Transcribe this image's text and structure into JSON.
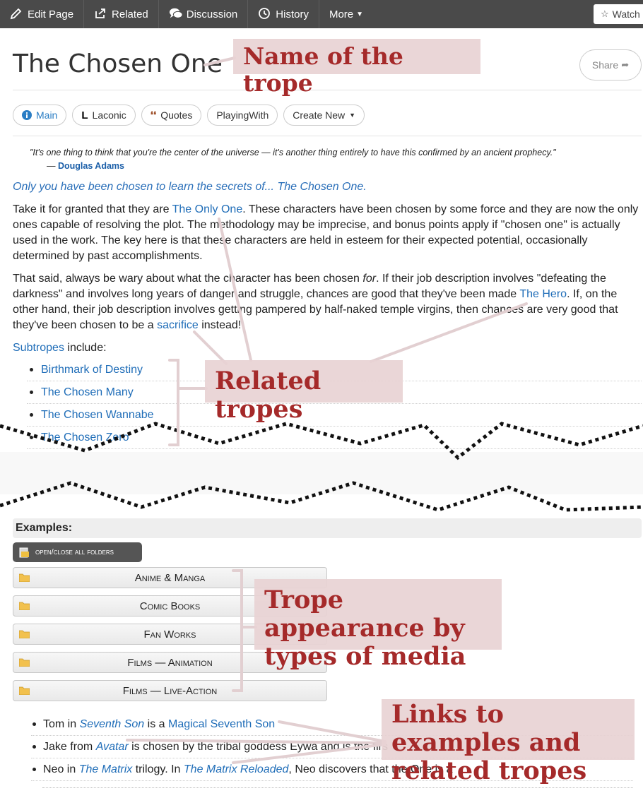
{
  "toolbar": {
    "edit_page": "Edit Page",
    "related": "Related",
    "discussion": "Discussion",
    "history": "History",
    "more": "More",
    "watch": "Watch"
  },
  "header": {
    "title": "The Chosen One",
    "share": "Share"
  },
  "tabs": {
    "main": "Main",
    "laconic": "Laconic",
    "quotes": "Quotes",
    "playingwith": "PlayingWith",
    "create_new": "Create New"
  },
  "quote": {
    "text": "\"It's one thing to think that you're the center of the universe — it's another thing entirely to have this confirmed by an ancient prophecy.\"",
    "dash": "— ",
    "author": "Douglas Adams"
  },
  "intro": "Only you have been chosen to learn the secrets of... The Chosen One.",
  "para1": {
    "a": "Take it for granted that they are ",
    "link": "The Only One",
    "b": ". These characters have been chosen by some force and they are now the only ones capable of resolving the plot. The methodology may be imprecise, and bonus points apply if \"chosen one\" is actually used in the work. The key here is that these characters are held in esteem for their expected potential, occasionally determined by past accomplishments."
  },
  "para2": {
    "a": "That said, always be wary about what the character has been chosen ",
    "em": "for",
    "b": ". If their job description involves \"defeating the darkness\" and involves long years of danger and struggle, chances are good that they've been made ",
    "link1": "The Hero",
    "c": ". If, on the other hand, their job description involves getting pampered by half-naked temple virgins, then chances are very good that they've been chosen to be a ",
    "link2": "sacrifice",
    "d": " instead!"
  },
  "subtropes": {
    "link": "Subtropes",
    "rest": " include:",
    "items": [
      "Birthmark of Destiny",
      "The Chosen Many",
      "The Chosen Wannabe",
      "The Chosen Zero"
    ]
  },
  "examples": {
    "header": "Examples:",
    "open_close": "open/close all folders",
    "folders": [
      "Anime & Manga",
      "Comic Books",
      "Fan Works",
      "Films — Animation",
      "Films — Live-Action"
    ],
    "items": [
      {
        "a": "Tom in ",
        "work": "Seventh Son",
        "b": " is a ",
        "link": "Magical Seventh Son",
        "c": ""
      },
      {
        "a": "Jake from ",
        "work": "Avatar",
        "b": " is chosen by the tribal goddess Eywa and is the firs",
        "link": "",
        "c": ""
      },
      {
        "a": "Neo in ",
        "work": "The Matrix",
        "b": " trilogy. In ",
        "link": "The Matrix Reloaded",
        "c": ", Neo discovers that the One is a "
      }
    ]
  },
  "annotations": {
    "name": "Name of the trope",
    "related": "Related tropes",
    "media": "Trope appearance by types of media",
    "links": "Links to examples and related tropes"
  },
  "colors": {
    "toolbar_bg": "#4a4a4a",
    "link": "#1f6db8",
    "callout_bg": "#e8d2d4",
    "callout_text": "#a52a2a"
  }
}
